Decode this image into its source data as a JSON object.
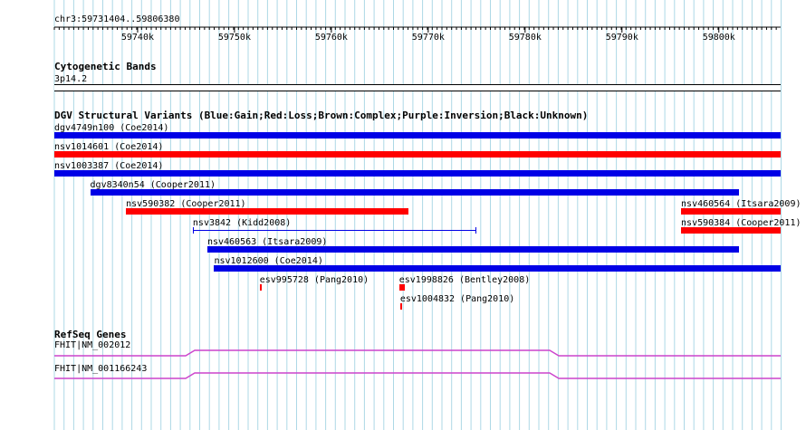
{
  "ruler": {
    "location": "chr3:59731404..59806380",
    "start": 59731404,
    "end": 59806380,
    "ticks": [
      "59740k",
      "59750k",
      "59760k",
      "59770k",
      "59780k",
      "59790k",
      "59800k"
    ]
  },
  "colors": {
    "gain": "#0000e6",
    "loss": "#ff0000",
    "grid": "#add8e6",
    "gene": "#cc44cc"
  },
  "cytoband": {
    "title": "Cytogenetic Bands",
    "band": "3p14.2"
  },
  "dgv": {
    "title": "DGV Structural Variants (Blue:Gain;Red:Loss;Brown:Complex;Purple:Inversion;Black:Unknown)",
    "features": [
      {
        "label": "dgv4749n100 (Coe2014)",
        "start": 59731404,
        "end": 59806380,
        "type": "gain"
      },
      {
        "label": "nsv1014601 (Coe2014)",
        "start": 59731404,
        "end": 59806380,
        "type": "loss"
      },
      {
        "label": "nsv1003387 (Coe2014)",
        "start": 59731404,
        "end": 59806380,
        "type": "gain"
      },
      {
        "label": "dgv8340n54 (Cooper2011)",
        "start": 59735100,
        "end": 59802100,
        "type": "gain"
      },
      {
        "label": "nsv590382 (Cooper2011)",
        "start": 59738800,
        "end": 59768000,
        "type": "loss"
      },
      {
        "label": "nsv460564 (Itsara2009)",
        "start": 59796100,
        "end": 59806380,
        "type": "loss"
      },
      {
        "label": "nsv3842 (Kidd2008)",
        "start": 59745700,
        "end": 59775000,
        "type": "line"
      },
      {
        "label": "nsv590384 (Cooper2011)",
        "start": 59796100,
        "end": 59806380,
        "type": "loss"
      },
      {
        "label": "nsv460563 (Itsara2009)",
        "start": 59747200,
        "end": 59802100,
        "type": "gain"
      },
      {
        "label": "nsv1012600 (Coe2014)",
        "start": 59747900,
        "end": 59806380,
        "type": "gain"
      },
      {
        "label": "esv995728 (Pang2010)",
        "start": 59752600,
        "end": 59752800,
        "type": "loss"
      },
      {
        "label": "esv1998826 (Bentley2008)",
        "start": 59767000,
        "end": 59767600,
        "type": "loss"
      },
      {
        "label": "esv1004832 (Pang2010)",
        "start": 59767100,
        "end": 59767300,
        "type": "loss"
      }
    ]
  },
  "refseq": {
    "title": "RefSeq Genes",
    "genes": [
      {
        "label": "FHIT|NM_002012"
      },
      {
        "label": "FHIT|NM_001166243"
      }
    ]
  }
}
